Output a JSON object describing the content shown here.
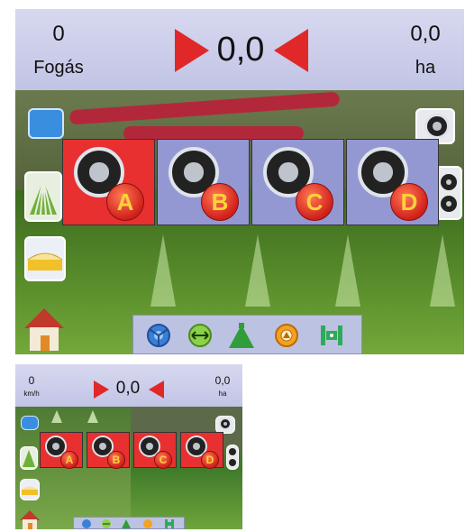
{
  "colors": {
    "header_bg": "#c8cae8",
    "boom_on": "#e83030",
    "boom_off": "#9498d2",
    "arrow": "#e02828",
    "badge_letter": "#ffd23a"
  },
  "large_display": {
    "left_readout": {
      "value": "0",
      "unit": "Fogás"
    },
    "center_readout": {
      "value": "0,0"
    },
    "right_readout": {
      "value": "0,0",
      "unit": "ha"
    },
    "side_buttons_left": [
      {
        "icon": "blue-screen-icon"
      },
      {
        "icon": "field-rows-icon"
      },
      {
        "icon": "boom-height-icon"
      },
      {
        "icon": "home-icon"
      }
    ],
    "side_buttons_right": [
      {
        "icon": "camera-icon"
      },
      {
        "icon": "dual-camera-icon"
      }
    ],
    "booms": [
      {
        "letter": "A",
        "state": "on"
      },
      {
        "letter": "B",
        "state": "off"
      },
      {
        "letter": "C",
        "state": "off"
      },
      {
        "letter": "D",
        "state": "off"
      }
    ],
    "toolbar": [
      {
        "icon": "steering-icon"
      },
      {
        "icon": "width-icon"
      },
      {
        "icon": "sprayer-icon"
      },
      {
        "icon": "camera-target-icon"
      },
      {
        "icon": "boom-section-icon"
      }
    ]
  },
  "small_display": {
    "left_readout": {
      "value": "0",
      "unit": "km/h"
    },
    "center_readout": {
      "value": "0,0"
    },
    "right_readout": {
      "value": "0,0",
      "unit": "ha"
    },
    "booms": [
      {
        "letter": "A",
        "state": "on"
      },
      {
        "letter": "B",
        "state": "on"
      },
      {
        "letter": "C",
        "state": "on"
      },
      {
        "letter": "D",
        "state": "on"
      }
    ]
  }
}
